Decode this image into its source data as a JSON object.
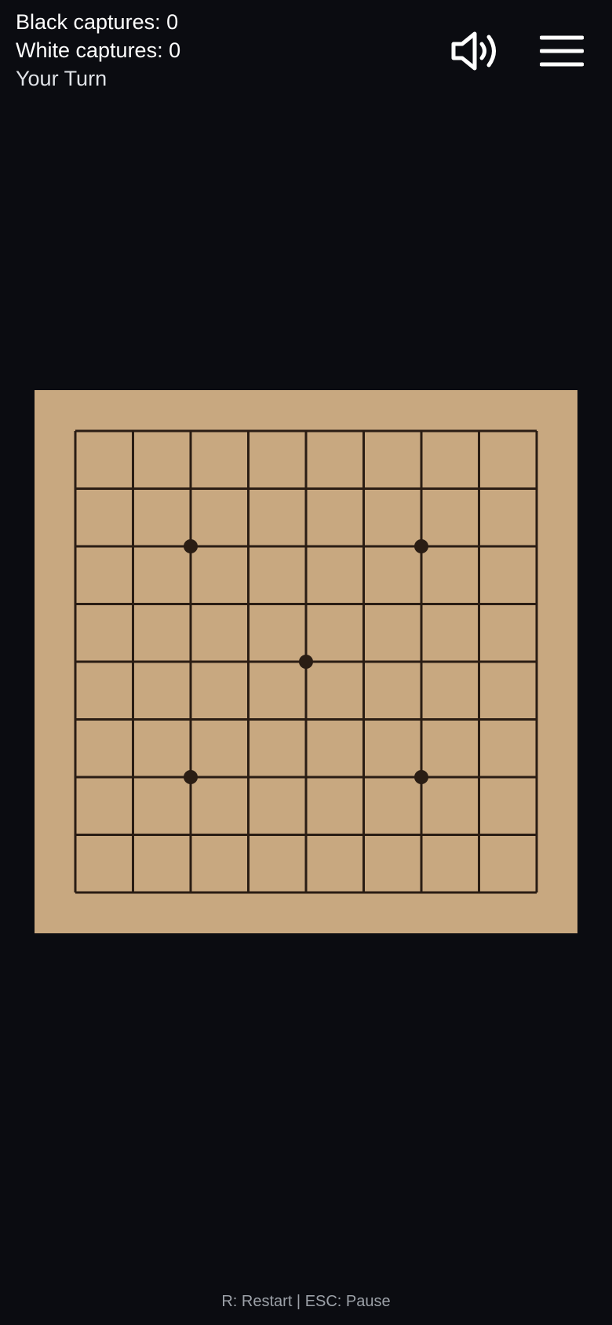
{
  "hud": {
    "black_captures": "Black captures: 0",
    "white_captures": "White captures: 0",
    "turn_status": "Your Turn"
  },
  "toolbar": {
    "sound_icon": "speaker-volume-icon",
    "menu_icon": "hamburger-menu-icon"
  },
  "board": {
    "size": 9,
    "star_points": [
      [
        2,
        2
      ],
      [
        6,
        2
      ],
      [
        4,
        4
      ],
      [
        2,
        6
      ],
      [
        6,
        6
      ]
    ],
    "stones": [],
    "colors": {
      "board": "#c8a880",
      "lines": "#2a1d14",
      "star_points": "#2a1d14"
    }
  },
  "footer": {
    "controls_hint": "R: Restart | ESC: Pause"
  },
  "colors": {
    "background": "#0b0c11",
    "text": "#ffffff",
    "hint_text": "#9ca1a8"
  }
}
